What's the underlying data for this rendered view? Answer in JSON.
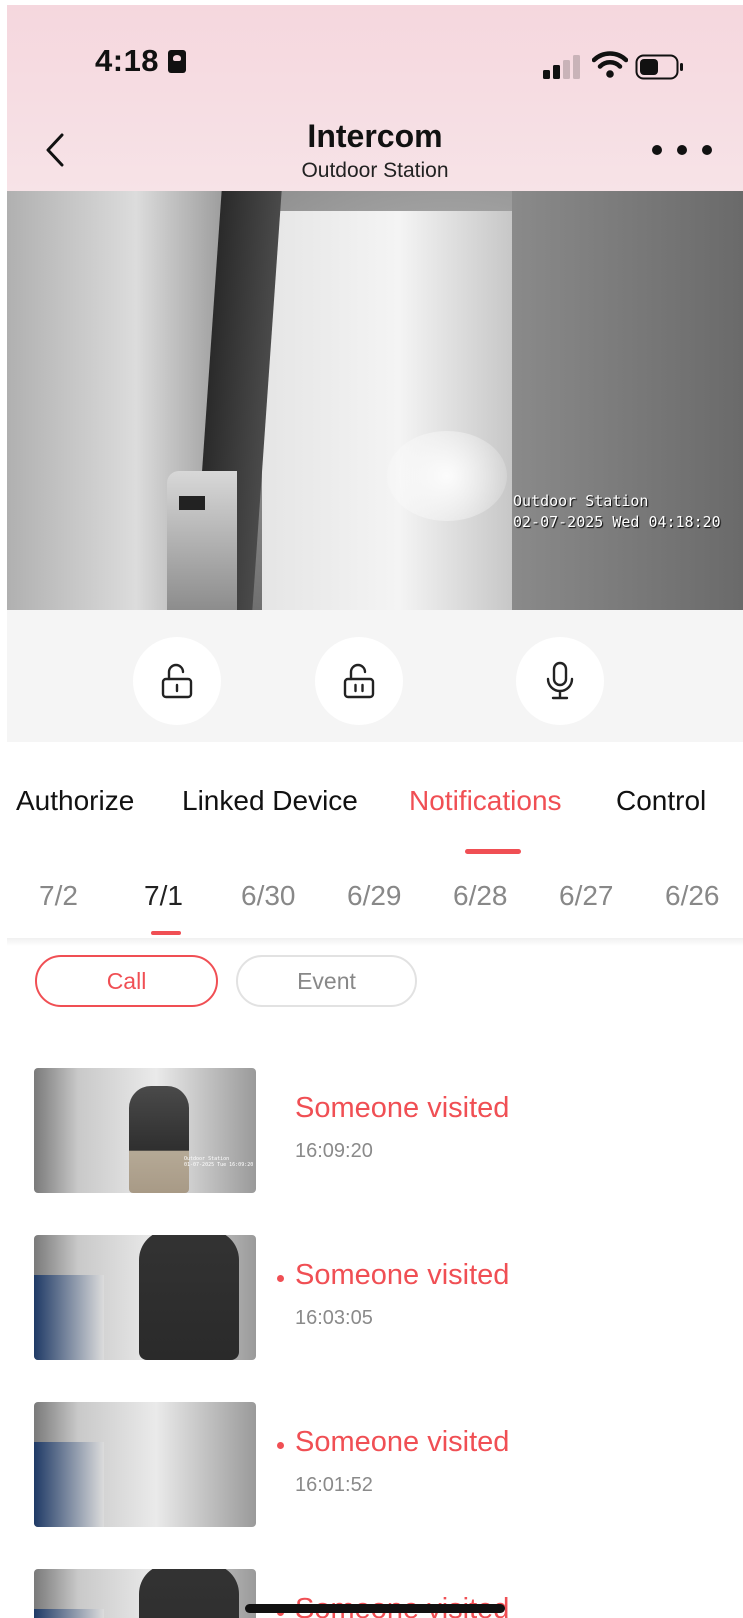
{
  "status_bar": {
    "time": "4:18"
  },
  "header": {
    "title": "Intercom",
    "subtitle": "Outdoor Station"
  },
  "video": {
    "osd_name": "Outdoor Station",
    "osd_datetime": "02-07-2025 Wed 04:18:20"
  },
  "controls": [
    {
      "icon": "unlock-icon"
    },
    {
      "icon": "unlock-icon"
    },
    {
      "icon": "microphone-icon"
    }
  ],
  "tabs": [
    "Authorize",
    "Linked Device",
    "Notifications",
    "Control"
  ],
  "active_tab": "Notifications",
  "dates": [
    "7/2",
    "7/1",
    "6/30",
    "6/29",
    "6/28",
    "6/27",
    "6/26"
  ],
  "active_date": "7/1",
  "filters": {
    "call": "Call",
    "event": "Event",
    "active": "Call"
  },
  "notifications": [
    {
      "title": "Someone visited",
      "time": "16:09:20",
      "unread": false
    },
    {
      "title": "Someone visited",
      "time": "16:03:05",
      "unread": true
    },
    {
      "title": "Someone visited",
      "time": "16:01:52",
      "unread": true
    },
    {
      "title": "Someone visited",
      "time": "",
      "unread": true
    }
  ],
  "colors": {
    "accent": "#f04f54",
    "header_bg": "#f5d7de"
  }
}
